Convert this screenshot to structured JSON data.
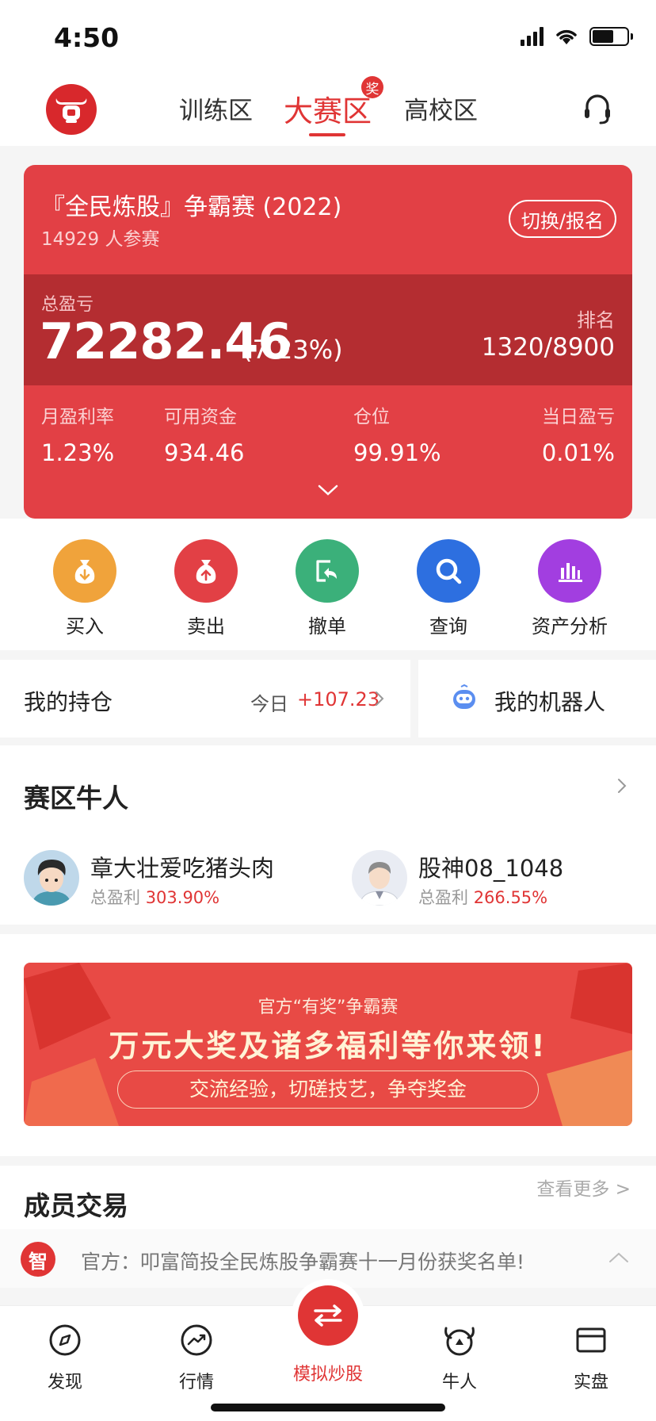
{
  "status_bar": {
    "time": "4:50",
    "battery_level": 0.62
  },
  "header": {
    "tabs": [
      {
        "label": "训练区",
        "active": false
      },
      {
        "label": "大赛区",
        "active": true,
        "badge": "奖"
      },
      {
        "label": "高校区",
        "active": false
      }
    ]
  },
  "contest": {
    "title": "『全民炼股』争霸赛 (2022)",
    "participants": "14929 人参赛",
    "switch_label": "切换/报名",
    "pnl_label": "总盈亏",
    "pnl_value": "72282.46",
    "pnl_pct": "(7.23%)",
    "rank_label": "排名",
    "rank_value": "1320/8900",
    "stats": [
      {
        "label": "月盈利率",
        "value": "1.23%"
      },
      {
        "label": "可用资金",
        "value": "934.46"
      },
      {
        "label": "仓位",
        "value": "99.91%"
      },
      {
        "label": "当日盈亏",
        "value": "0.01%"
      }
    ]
  },
  "actions": [
    {
      "label": "买入",
      "icon": "money-bag-down-icon",
      "color": "#f0a33b"
    },
    {
      "label": "卖出",
      "icon": "money-bag-up-icon",
      "color": "#e24045"
    },
    {
      "label": "撤单",
      "icon": "undo-icon",
      "color": "#3bb07a"
    },
    {
      "label": "查询",
      "icon": "search-icon",
      "color": "#2d6fe0"
    },
    {
      "label": "资产分析",
      "icon": "bar-chart-icon",
      "color": "#a23ee0"
    }
  ],
  "holdings": {
    "title": "我的持仓",
    "today_label": "今日",
    "today_value": "+107.23"
  },
  "robot": {
    "title": "我的机器人"
  },
  "experts": {
    "title": "赛区牛人",
    "items": [
      {
        "name": "章大壮爱吃猪头肉",
        "stat_label": "总盈利",
        "stat_value": "303.90%"
      },
      {
        "name": "股神08_1048",
        "stat_label": "总盈利",
        "stat_value": "266.55%"
      }
    ]
  },
  "banner": {
    "top": "官方“有奖”争霸赛",
    "main": "万元大奖及诸多福利等你来领!",
    "pill": "交流经验，切磋技艺，争夺奖金"
  },
  "members": {
    "title": "成员交易",
    "more": "查看更多 >"
  },
  "notice": {
    "icon_text": "智",
    "text": "官方：叩富简投全民炼股争霸赛十一月份获奖名单!"
  },
  "tabbar": [
    {
      "label": "发现",
      "icon": "compass-icon"
    },
    {
      "label": "行情",
      "icon": "trend-chart-icon"
    },
    {
      "label": "模拟炒股",
      "icon": "swap-arrows-icon",
      "active": true
    },
    {
      "label": "牛人",
      "icon": "bull-icon"
    },
    {
      "label": "实盘",
      "icon": "wallet-icon"
    }
  ],
  "colors": {
    "accent": "#e03535",
    "card": "#e24045",
    "card_band": "#b42d31"
  }
}
